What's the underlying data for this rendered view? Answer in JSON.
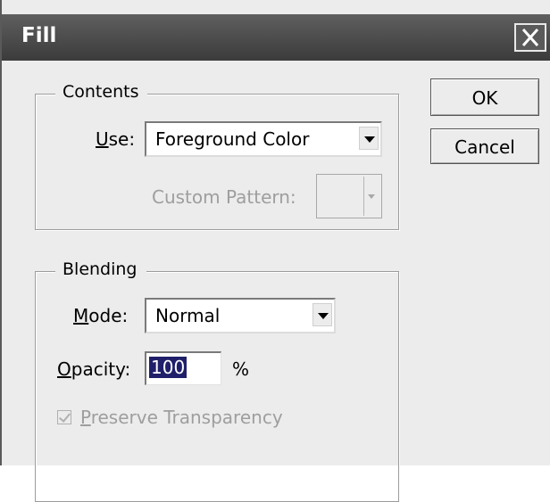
{
  "window": {
    "title": "Fill"
  },
  "contents": {
    "group_label": "Contents",
    "use_label_underlined": "U",
    "use_label_rest": "se:",
    "use_value": "Foreground Color",
    "custom_pattern_label": "Custom Pattern:"
  },
  "blending": {
    "group_label": "Blending",
    "mode_label_underlined": "M",
    "mode_label_rest": "ode:",
    "mode_value": "Normal",
    "opacity_label_underlined": "O",
    "opacity_label_rest": "pacity:",
    "opacity_value": "100",
    "opacity_unit": "%",
    "preserve_label_underlined": "P",
    "preserve_label_rest": "reserve Transparency",
    "preserve_checked": true,
    "preserve_enabled": false
  },
  "buttons": {
    "ok": "OK",
    "cancel": "Cancel"
  },
  "icons": {
    "close": "close-icon",
    "dropdown": "chevron-down-icon"
  }
}
